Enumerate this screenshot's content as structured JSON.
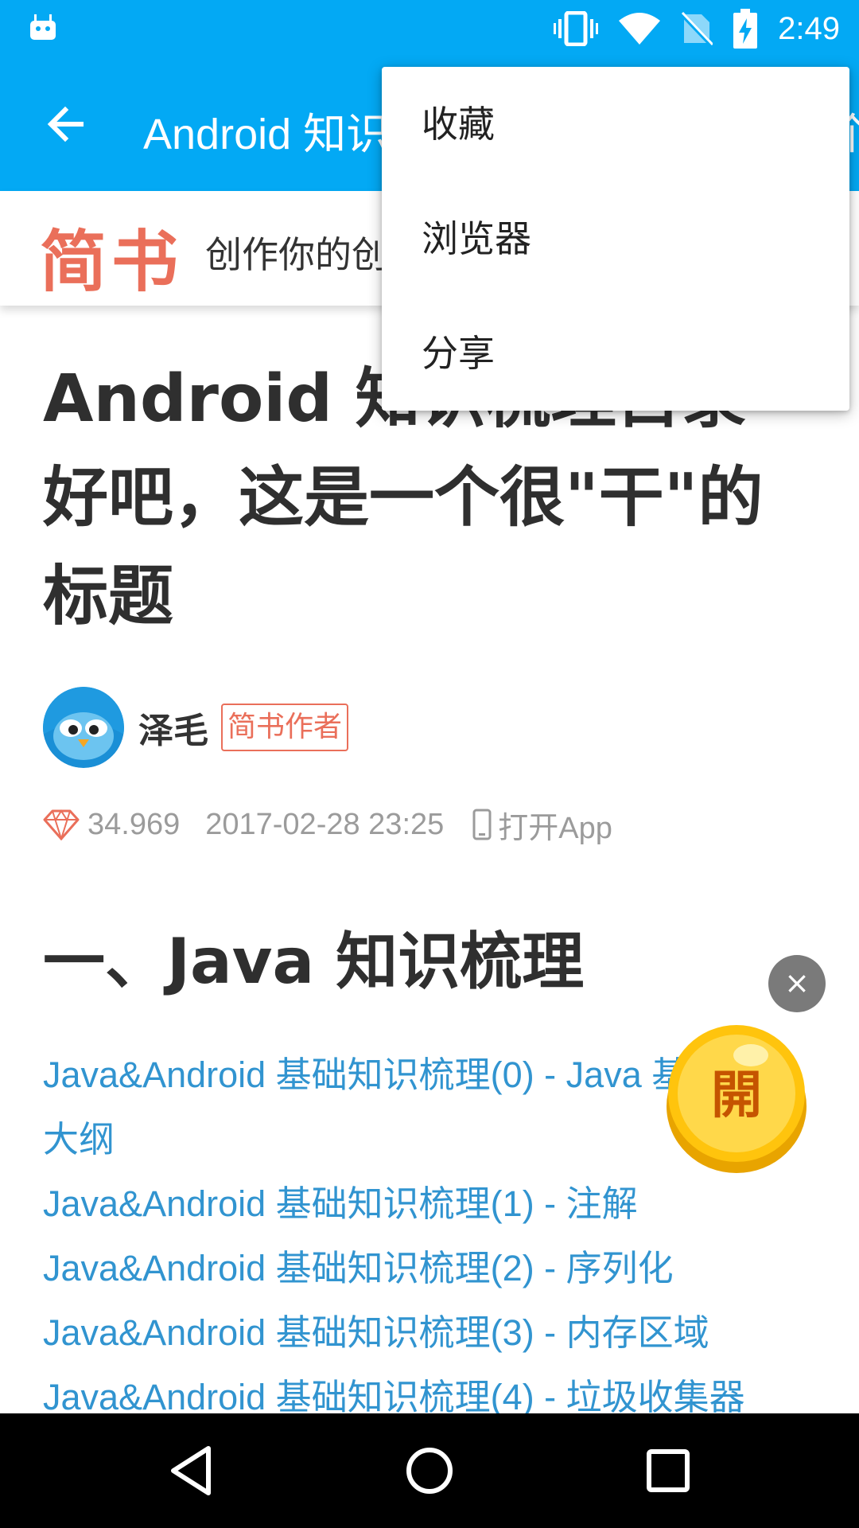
{
  "status_bar": {
    "time": "2:49",
    "icons": [
      "android-notification-icon",
      "vibrate-icon",
      "wifi-icon",
      "no-sim-icon",
      "battery-charging-icon"
    ]
  },
  "app_bar": {
    "title": "Android 知识梳理目录 好吧，这是一个很\"干\"的标题",
    "back_icon": "arrow-left-icon"
  },
  "popup_menu": {
    "items": [
      "收藏",
      "浏览器",
      "分享"
    ]
  },
  "jianshu_header": {
    "logo": "简书",
    "slogan": "创作你的创作"
  },
  "article": {
    "title": "Android 知识梳理目录 好吧，这是一个很\"干\"的标题",
    "author": {
      "name": "泽毛",
      "badge": "简书作者"
    },
    "meta": {
      "diamond_value": "34.969",
      "datetime": "2017-02-28 23:25",
      "open_app": "打开App"
    },
    "section_heading": "一、Java 知识梳理",
    "links": [
      "Java&Android 基础知识梳理(0) - Java 基础知识大纲",
      "Java&Android 基础知识梳理(1) - 注解",
      "Java&Android 基础知识梳理(2) - 序列化",
      "Java&Android 基础知识梳理(3) - 内存区域",
      "Java&Android 基础知识梳理(4) - 垃圾收集器"
    ]
  },
  "floating": {
    "close_label": "×",
    "coin_label": "開"
  },
  "colors": {
    "primary": "#03a9f4",
    "jianshu_red": "#ea6f5a",
    "link_blue": "#3194d0",
    "meta_gray": "#9b9b9b"
  }
}
